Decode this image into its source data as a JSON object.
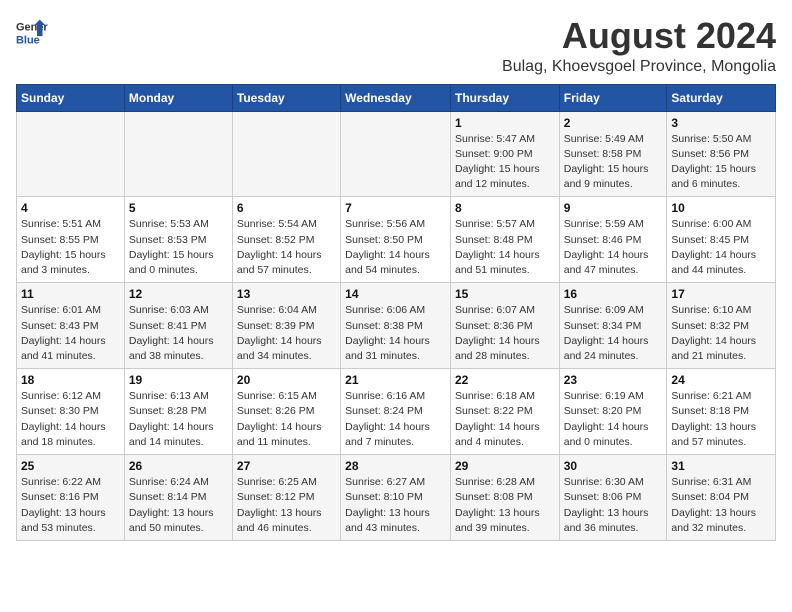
{
  "logo": {
    "general": "General",
    "blue": "Blue"
  },
  "title": "August 2024",
  "location": "Bulag, Khoevsgoel Province, Mongolia",
  "headers": [
    "Sunday",
    "Monday",
    "Tuesday",
    "Wednesday",
    "Thursday",
    "Friday",
    "Saturday"
  ],
  "weeks": [
    [
      {
        "day": "",
        "detail": ""
      },
      {
        "day": "",
        "detail": ""
      },
      {
        "day": "",
        "detail": ""
      },
      {
        "day": "",
        "detail": ""
      },
      {
        "day": "1",
        "detail": "Sunrise: 5:47 AM\nSunset: 9:00 PM\nDaylight: 15 hours\nand 12 minutes."
      },
      {
        "day": "2",
        "detail": "Sunrise: 5:49 AM\nSunset: 8:58 PM\nDaylight: 15 hours\nand 9 minutes."
      },
      {
        "day": "3",
        "detail": "Sunrise: 5:50 AM\nSunset: 8:56 PM\nDaylight: 15 hours\nand 6 minutes."
      }
    ],
    [
      {
        "day": "4",
        "detail": "Sunrise: 5:51 AM\nSunset: 8:55 PM\nDaylight: 15 hours\nand 3 minutes."
      },
      {
        "day": "5",
        "detail": "Sunrise: 5:53 AM\nSunset: 8:53 PM\nDaylight: 15 hours\nand 0 minutes."
      },
      {
        "day": "6",
        "detail": "Sunrise: 5:54 AM\nSunset: 8:52 PM\nDaylight: 14 hours\nand 57 minutes."
      },
      {
        "day": "7",
        "detail": "Sunrise: 5:56 AM\nSunset: 8:50 PM\nDaylight: 14 hours\nand 54 minutes."
      },
      {
        "day": "8",
        "detail": "Sunrise: 5:57 AM\nSunset: 8:48 PM\nDaylight: 14 hours\nand 51 minutes."
      },
      {
        "day": "9",
        "detail": "Sunrise: 5:59 AM\nSunset: 8:46 PM\nDaylight: 14 hours\nand 47 minutes."
      },
      {
        "day": "10",
        "detail": "Sunrise: 6:00 AM\nSunset: 8:45 PM\nDaylight: 14 hours\nand 44 minutes."
      }
    ],
    [
      {
        "day": "11",
        "detail": "Sunrise: 6:01 AM\nSunset: 8:43 PM\nDaylight: 14 hours\nand 41 minutes."
      },
      {
        "day": "12",
        "detail": "Sunrise: 6:03 AM\nSunset: 8:41 PM\nDaylight: 14 hours\nand 38 minutes."
      },
      {
        "day": "13",
        "detail": "Sunrise: 6:04 AM\nSunset: 8:39 PM\nDaylight: 14 hours\nand 34 minutes."
      },
      {
        "day": "14",
        "detail": "Sunrise: 6:06 AM\nSunset: 8:38 PM\nDaylight: 14 hours\nand 31 minutes."
      },
      {
        "day": "15",
        "detail": "Sunrise: 6:07 AM\nSunset: 8:36 PM\nDaylight: 14 hours\nand 28 minutes."
      },
      {
        "day": "16",
        "detail": "Sunrise: 6:09 AM\nSunset: 8:34 PM\nDaylight: 14 hours\nand 24 minutes."
      },
      {
        "day": "17",
        "detail": "Sunrise: 6:10 AM\nSunset: 8:32 PM\nDaylight: 14 hours\nand 21 minutes."
      }
    ],
    [
      {
        "day": "18",
        "detail": "Sunrise: 6:12 AM\nSunset: 8:30 PM\nDaylight: 14 hours\nand 18 minutes."
      },
      {
        "day": "19",
        "detail": "Sunrise: 6:13 AM\nSunset: 8:28 PM\nDaylight: 14 hours\nand 14 minutes."
      },
      {
        "day": "20",
        "detail": "Sunrise: 6:15 AM\nSunset: 8:26 PM\nDaylight: 14 hours\nand 11 minutes."
      },
      {
        "day": "21",
        "detail": "Sunrise: 6:16 AM\nSunset: 8:24 PM\nDaylight: 14 hours\nand 7 minutes."
      },
      {
        "day": "22",
        "detail": "Sunrise: 6:18 AM\nSunset: 8:22 PM\nDaylight: 14 hours\nand 4 minutes."
      },
      {
        "day": "23",
        "detail": "Sunrise: 6:19 AM\nSunset: 8:20 PM\nDaylight: 14 hours\nand 0 minutes."
      },
      {
        "day": "24",
        "detail": "Sunrise: 6:21 AM\nSunset: 8:18 PM\nDaylight: 13 hours\nand 57 minutes."
      }
    ],
    [
      {
        "day": "25",
        "detail": "Sunrise: 6:22 AM\nSunset: 8:16 PM\nDaylight: 13 hours\nand 53 minutes."
      },
      {
        "day": "26",
        "detail": "Sunrise: 6:24 AM\nSunset: 8:14 PM\nDaylight: 13 hours\nand 50 minutes."
      },
      {
        "day": "27",
        "detail": "Sunrise: 6:25 AM\nSunset: 8:12 PM\nDaylight: 13 hours\nand 46 minutes."
      },
      {
        "day": "28",
        "detail": "Sunrise: 6:27 AM\nSunset: 8:10 PM\nDaylight: 13 hours\nand 43 minutes."
      },
      {
        "day": "29",
        "detail": "Sunrise: 6:28 AM\nSunset: 8:08 PM\nDaylight: 13 hours\nand 39 minutes."
      },
      {
        "day": "30",
        "detail": "Sunrise: 6:30 AM\nSunset: 8:06 PM\nDaylight: 13 hours\nand 36 minutes."
      },
      {
        "day": "31",
        "detail": "Sunrise: 6:31 AM\nSunset: 8:04 PM\nDaylight: 13 hours\nand 32 minutes."
      }
    ]
  ]
}
